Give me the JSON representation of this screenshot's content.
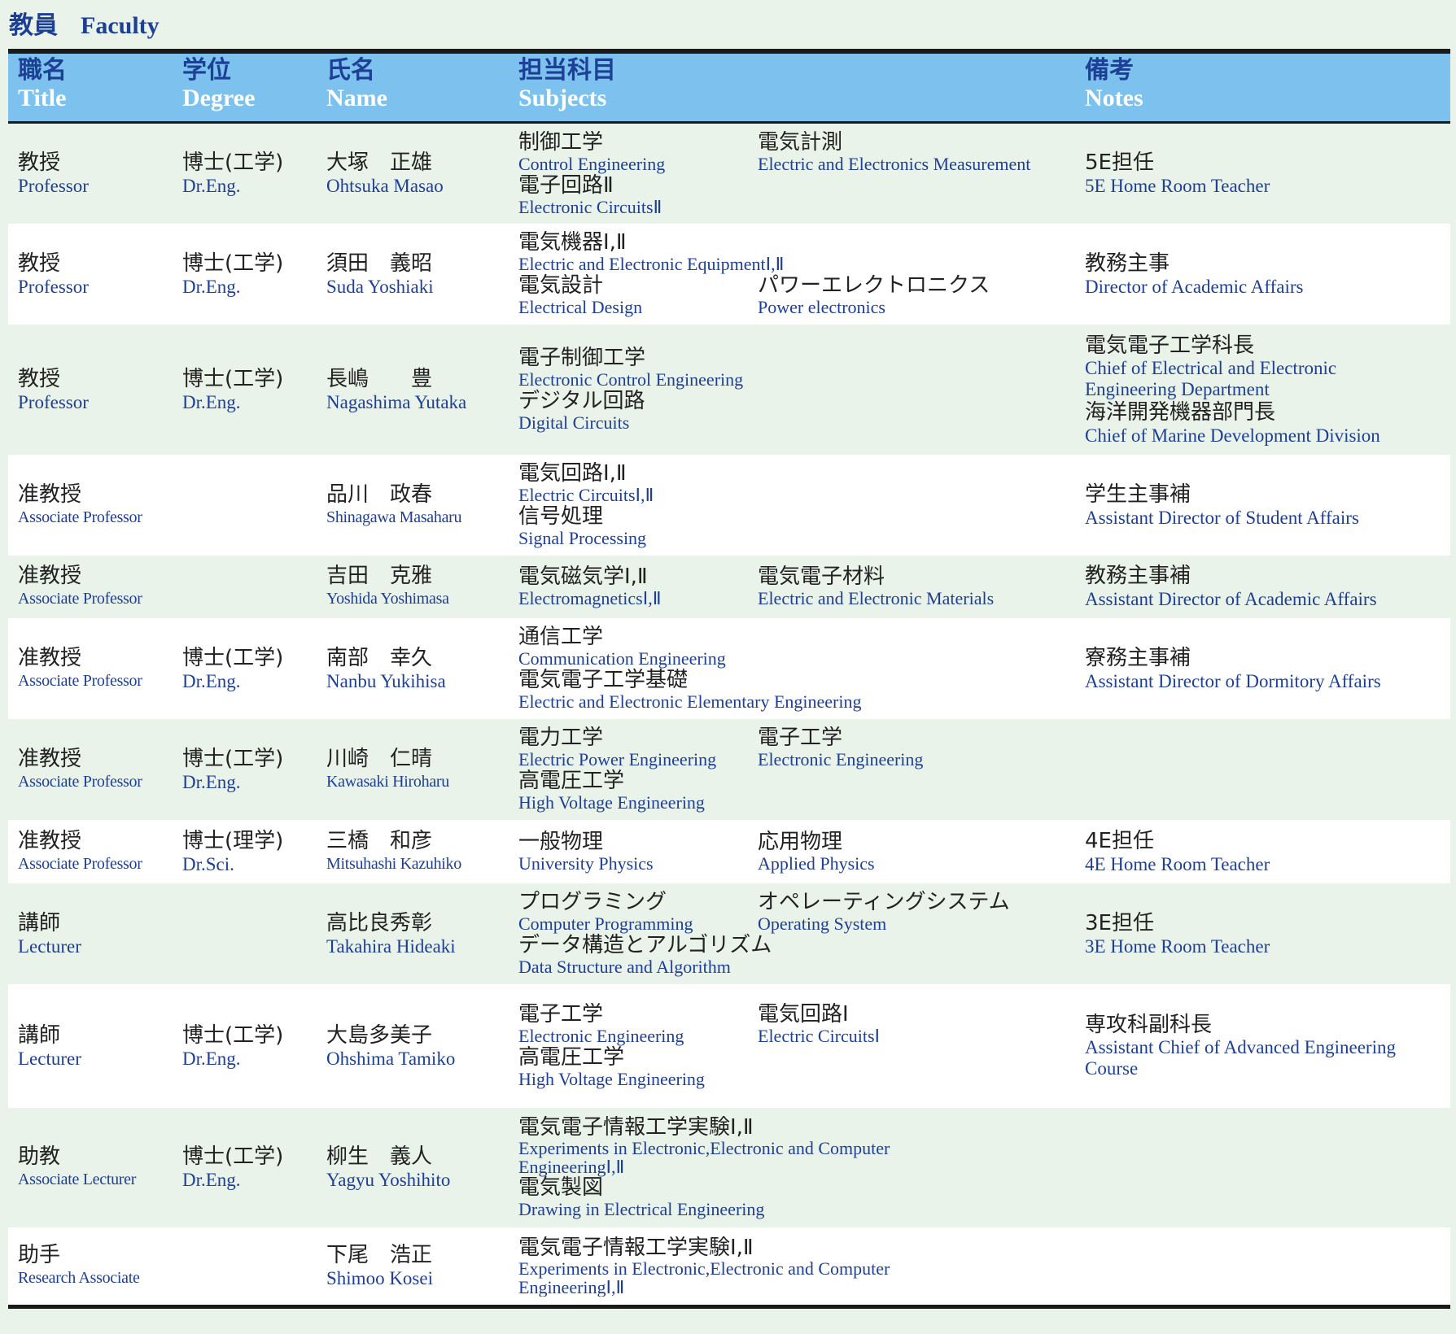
{
  "page": {
    "title_ja": "教員",
    "title_en": "Faculty"
  },
  "header": {
    "title_ja": "職名",
    "title_en": "Title",
    "degree_ja": "学位",
    "degree_en": "Degree",
    "name_ja": "氏名",
    "name_en": "Name",
    "subjects_ja": "担当科目",
    "subjects_en": "Subjects",
    "notes_ja": "備考",
    "notes_en": "Notes"
  },
  "rows": [
    {
      "title_ja": "教授",
      "title_en": "Professor",
      "degree_ja": "博士(工学)",
      "degree_en": "Dr.Eng.",
      "name_ja": "大塚　正雄",
      "name_en": "Ohtsuka Masao",
      "subjects": [
        {
          "ja": "制御工学",
          "en": "Control Engineering"
        },
        {
          "ja": "電気計測",
          "en": "Electric and Electronics Measurement"
        },
        {
          "ja": "電子回路Ⅱ",
          "en": "Electronic CircuitsⅡ"
        }
      ],
      "notes": [
        {
          "ja": "5E担任",
          "en": "5E Home Room Teacher"
        }
      ]
    },
    {
      "title_ja": "教授",
      "title_en": "Professor",
      "degree_ja": "博士(工学)",
      "degree_en": "Dr.Eng.",
      "name_ja": "須田　義昭",
      "name_en": "Suda Yoshiaki",
      "subjects": [
        {
          "ja": "電気機器Ⅰ,Ⅱ",
          "en": "Electric and Electronic EquipmentⅠ,Ⅱ"
        },
        {
          "ja": "電気設計",
          "en": "Electrical Design"
        },
        {
          "ja": "パワーエレクトロニクス",
          "en": "Power electronics"
        }
      ],
      "notes": [
        {
          "ja": "教務主事",
          "en": "Director of Academic Affairs"
        }
      ]
    },
    {
      "title_ja": "教授",
      "title_en": "Professor",
      "degree_ja": "博士(工学)",
      "degree_en": "Dr.Eng.",
      "name_ja": "長嶋　　豊",
      "name_en": "Nagashima Yutaka",
      "subjects": [
        {
          "ja": "電子制御工学",
          "en": "Electronic Control Engineering"
        },
        {
          "ja": "デジタル回路",
          "en": "Digital Circuits"
        }
      ],
      "notes": [
        {
          "ja": "電気電子工学科長",
          "en": "Chief of Electrical and Electronic Engineering Department"
        },
        {
          "ja": "海洋開発機器部門長",
          "en": "Chief of Marine Development Division"
        }
      ]
    },
    {
      "title_ja": "准教授",
      "title_en": "Associate Professor",
      "degree_ja": "",
      "degree_en": "",
      "name_ja": "品川　政春",
      "name_en": "Shinagawa Masaharu",
      "subjects": [
        {
          "ja": "電気回路Ⅰ,Ⅱ",
          "en": "Electric CircuitsⅠ,Ⅱ"
        },
        {
          "ja": "信号処理",
          "en": "Signal Processing"
        }
      ],
      "notes": [
        {
          "ja": "学生主事補",
          "en": "Assistant Director of Student Affairs"
        }
      ]
    },
    {
      "title_ja": "准教授",
      "title_en": "Associate Professor",
      "degree_ja": "",
      "degree_en": "",
      "name_ja": "吉田　克雅",
      "name_en": "Yoshida Yoshimasa",
      "subjects": [
        {
          "ja": "電気磁気学Ⅰ,Ⅱ",
          "en": "ElectromagneticsⅠ,Ⅱ"
        },
        {
          "ja": "電気電子材料",
          "en": "Electric and Electronic Materials"
        }
      ],
      "notes": [
        {
          "ja": "教務主事補",
          "en": "Assistant Director of Academic Affairs"
        }
      ]
    },
    {
      "title_ja": "准教授",
      "title_en": "Associate Professor",
      "degree_ja": "博士(工学)",
      "degree_en": "Dr.Eng.",
      "name_ja": "南部　幸久",
      "name_en": "Nanbu Yukihisa",
      "subjects": [
        {
          "ja": "通信工学",
          "en": "Communication Engineering"
        },
        {
          "ja": "電気電子工学基礎",
          "en": "Electric and Electronic Elementary Engineering"
        }
      ],
      "notes": [
        {
          "ja": "寮務主事補",
          "en": "Assistant Director of Dormitory Affairs"
        }
      ]
    },
    {
      "title_ja": "准教授",
      "title_en": "Associate Professor",
      "degree_ja": "博士(工学)",
      "degree_en": "Dr.Eng.",
      "name_ja": "川崎　仁晴",
      "name_en": "Kawasaki Hiroharu",
      "subjects": [
        {
          "ja": "電力工学",
          "en": "Electric Power Engineering"
        },
        {
          "ja": "電子工学",
          "en": "Electronic Engineering"
        },
        {
          "ja": "高電圧工学",
          "en": "High Voltage Engineering"
        }
      ],
      "notes": []
    },
    {
      "title_ja": "准教授",
      "title_en": "Associate Professor",
      "degree_ja": "博士(理学)",
      "degree_en": "Dr.Sci.",
      "name_ja": "三橋　和彦",
      "name_en": "Mitsuhashi Kazuhiko",
      "subjects": [
        {
          "ja": "一般物理",
          "en": "University Physics"
        },
        {
          "ja": "応用物理",
          "en": "Applied Physics"
        }
      ],
      "notes": [
        {
          "ja": "4E担任",
          "en": "4E Home Room Teacher"
        }
      ]
    },
    {
      "title_ja": "講師",
      "title_en": "Lecturer",
      "degree_ja": "",
      "degree_en": "",
      "name_ja": "高比良秀彰",
      "name_en": "Takahira Hideaki",
      "subjects": [
        {
          "ja": "プログラミング",
          "en": "Computer Programming"
        },
        {
          "ja": "オペレーティングシステム",
          "en": "Operating System"
        },
        {
          "ja": "データ構造とアルゴリズム",
          "en": "Data Structure and Algorithm"
        }
      ],
      "notes": [
        {
          "ja": "3E担任",
          "en": "3E Home Room Teacher"
        }
      ]
    },
    {
      "title_ja": "講師",
      "title_en": "Lecturer",
      "degree_ja": "博士(工学)",
      "degree_en": "Dr.Eng.",
      "name_ja": "大島多美子",
      "name_en": "Ohshima Tamiko",
      "subjects": [
        {
          "ja": "電子工学",
          "en": "Electronic Engineering"
        },
        {
          "ja": "電気回路Ⅰ",
          "en": "Electric CircuitsⅠ"
        },
        {
          "ja": "高電圧工学",
          "en": "High Voltage Engineering"
        }
      ],
      "notes": [
        {
          "ja": "専攻科副科長",
          "en": "Assistant Chief of Advanced Engineering Course"
        }
      ]
    },
    {
      "title_ja": "助教",
      "title_en": "Associate Lecturer",
      "degree_ja": "博士(工学)",
      "degree_en": "Dr.Eng.",
      "name_ja": "柳生　義人",
      "name_en": "Yagyu Yoshihito",
      "subjects": [
        {
          "ja": "電気電子情報工学実験Ⅰ,Ⅱ",
          "en": "Experiments in Electronic,Electronic and Computer EngineeringⅠ,Ⅱ"
        },
        {
          "ja": "電気製図",
          "en": "Drawing in Electrical Engineering"
        }
      ],
      "notes": []
    },
    {
      "title_ja": "助手",
      "title_en": "Research Associate",
      "degree_ja": "",
      "degree_en": "",
      "name_ja": "下尾　浩正",
      "name_en": "Shimoo Kosei",
      "subjects": [
        {
          "ja": "電気電子情報工学実験Ⅰ,Ⅱ",
          "en": "Experiments in Electronic,Electronic and Computer EngineeringⅠ,Ⅱ"
        }
      ],
      "notes": []
    }
  ],
  "colors": {
    "header_bg": "#7dc2ef",
    "accent_text": "#1d3f95",
    "page_bg": "#eaf3ea",
    "row_white": "#ffffff"
  }
}
